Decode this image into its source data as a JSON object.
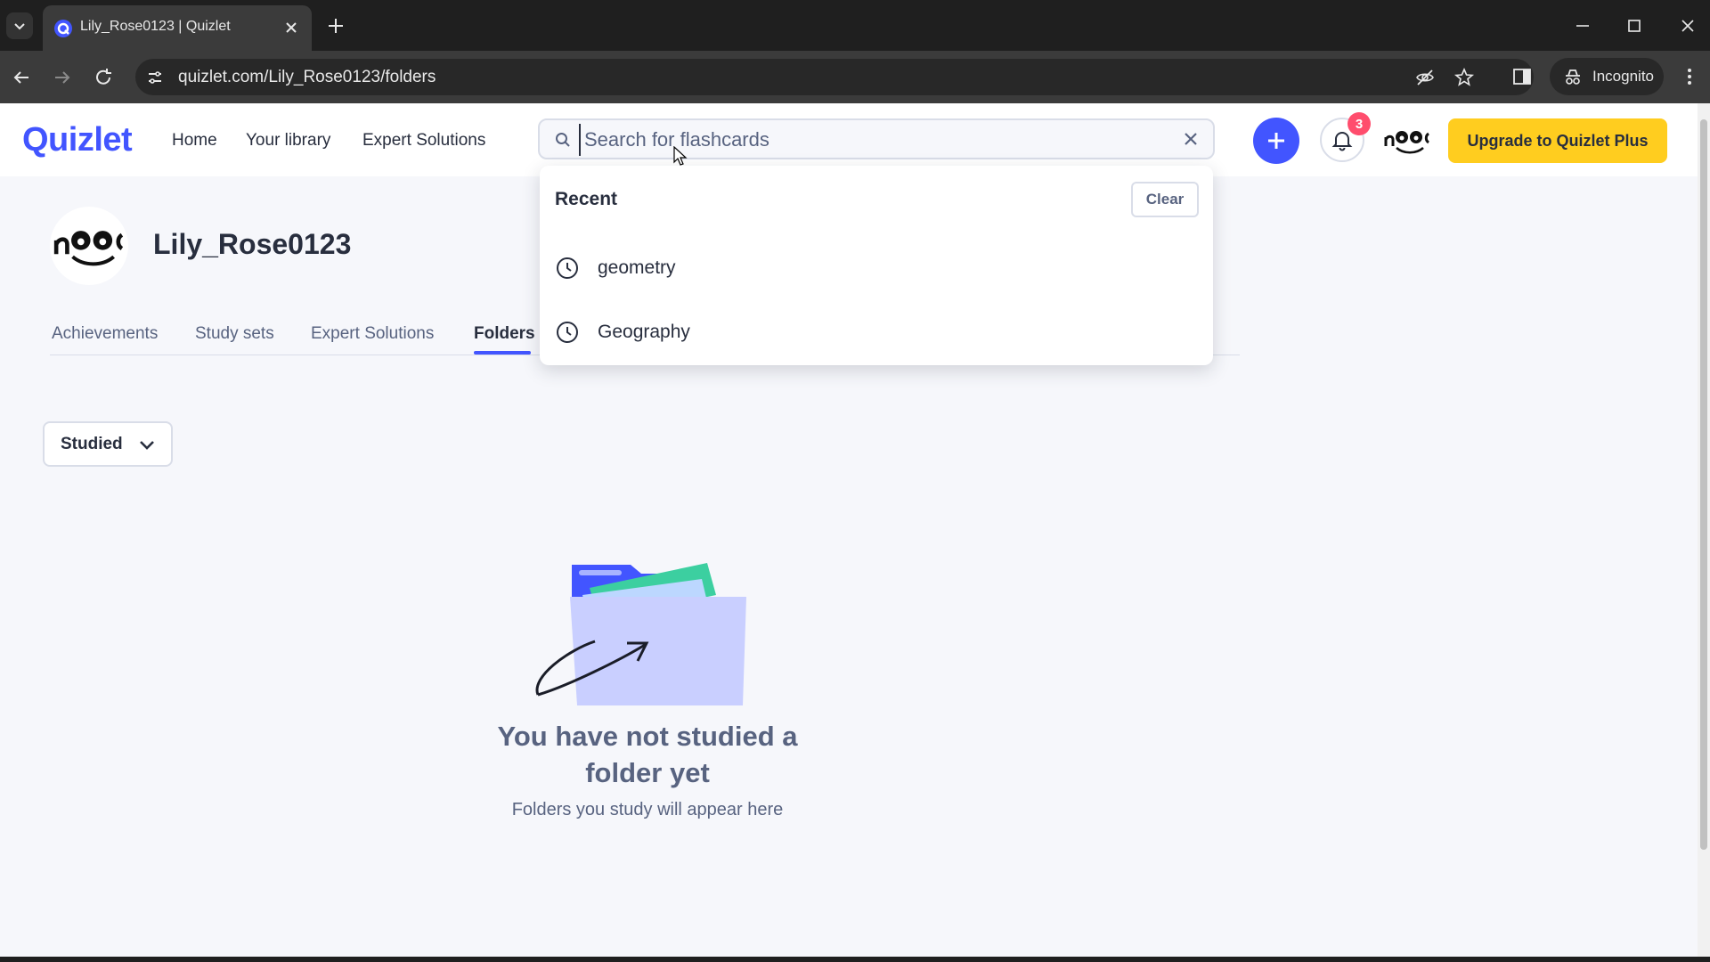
{
  "browser": {
    "tab_title": "Lily_Rose0123 | Quizlet",
    "url": "quizlet.com/Lily_Rose0123/folders",
    "incognito_label": "Incognito"
  },
  "header": {
    "logo": "Quizlet",
    "nav": [
      "Home",
      "Your library",
      "Expert Solutions"
    ],
    "search_placeholder": "Search for flashcards",
    "notification_count": "3",
    "upgrade_label": "Upgrade to Quizlet Plus"
  },
  "profile": {
    "username": "Lily_Rose0123",
    "tabs": [
      "Achievements",
      "Study sets",
      "Expert Solutions",
      "Folders"
    ],
    "active_tab": "Folders"
  },
  "filter": {
    "selected": "Studied"
  },
  "empty_state": {
    "title": "You have not studied a folder yet",
    "subtitle": "Folders you study will appear here"
  },
  "search_dropdown": {
    "heading": "Recent",
    "clear_label": "Clear",
    "items": [
      "geometry",
      "Geography"
    ]
  },
  "colors": {
    "brand": "#4255ff",
    "upgrade": "#ffcd1f",
    "badge": "#ff4d6d"
  }
}
